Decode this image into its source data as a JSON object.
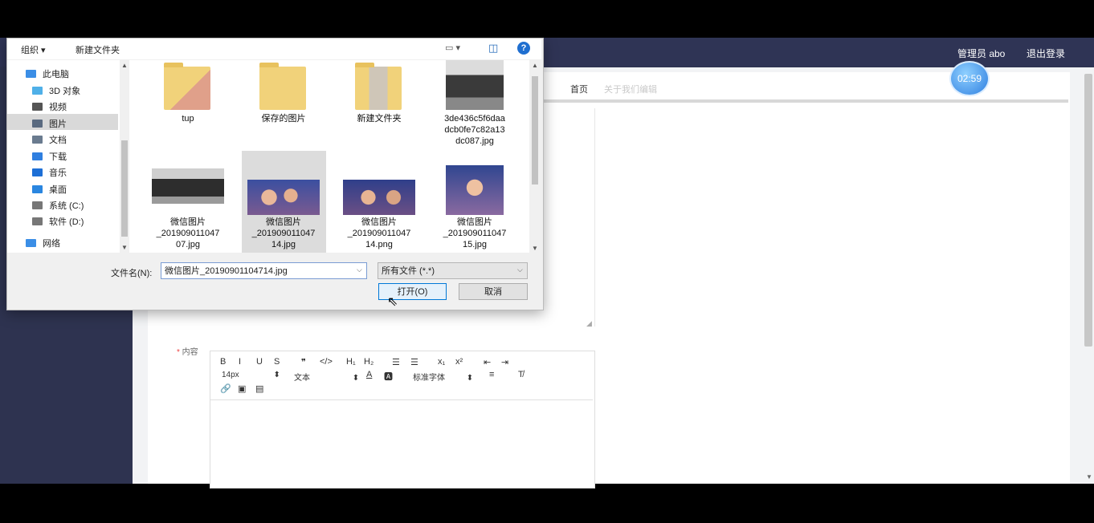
{
  "app": {
    "admin_label": "管理员 abo",
    "logout_label": "退出登录",
    "timer": "02:59",
    "breadcrumb": {
      "home": "首页",
      "current": "关于我们编辑"
    },
    "content_label": "内容",
    "editor": {
      "row1": [
        "B",
        "I",
        "U",
        "S",
        "❞",
        "</>",
        "H₁",
        "H₂",
        "☰",
        "☰",
        "x₁",
        "x²",
        "⇤",
        "⇥"
      ],
      "font_size": "14px",
      "text_style": "文本",
      "font_family": "标准字体"
    }
  },
  "dialog": {
    "commands": {
      "organize": "组织 ▾",
      "new_folder": "新建文件夹"
    },
    "nav_items": [
      {
        "label": "此电脑",
        "icon": "computer-icon",
        "color": "#3b8ee6"
      },
      {
        "label": "3D 对象",
        "icon": "cube-icon",
        "color": "#4fb0e8"
      },
      {
        "label": "视频",
        "icon": "video-icon",
        "color": "#555555"
      },
      {
        "label": "图片",
        "icon": "picture-icon",
        "color": "#5a6a80"
      },
      {
        "label": "文档",
        "icon": "document-icon",
        "color": "#6a7b8f"
      },
      {
        "label": "下载",
        "icon": "download-icon",
        "color": "#2f7fe0"
      },
      {
        "label": "音乐",
        "icon": "music-icon",
        "color": "#1d6fd6"
      },
      {
        "label": "桌面",
        "icon": "desktop-icon",
        "color": "#2a86e0"
      },
      {
        "label": "系统 (C:)",
        "icon": "drive-icon",
        "color": "#777777"
      },
      {
        "label": "软件 (D:)",
        "icon": "drive-icon",
        "color": "#777777"
      },
      {
        "label": "网络",
        "icon": "network-icon",
        "color": "#3b8ee6"
      }
    ],
    "files": [
      {
        "name": "tup",
        "kind": "folder"
      },
      {
        "name": "保存的图片",
        "kind": "folder"
      },
      {
        "name": "新建文件夹",
        "kind": "folder"
      },
      {
        "name": "3de436c5f6daa dcb0fe7c82a13 dc087.jpg",
        "kind": "image"
      },
      {
        "name": "微信图片 _201909011047 07.jpg",
        "kind": "image"
      },
      {
        "name": "微信图片 _201909011047 14.jpg",
        "kind": "image",
        "selected": true
      },
      {
        "name": "微信图片 _201909011047 14.png",
        "kind": "image"
      },
      {
        "name": "微信图片 _201909011047 15.jpg",
        "kind": "image"
      }
    ],
    "filename_label": "文件名(N):",
    "filename_value": "微信图片_20190901104714.jpg",
    "filter_value": "所有文件 (*.*)",
    "open_label": "打开(O)",
    "cancel_label": "取消"
  }
}
